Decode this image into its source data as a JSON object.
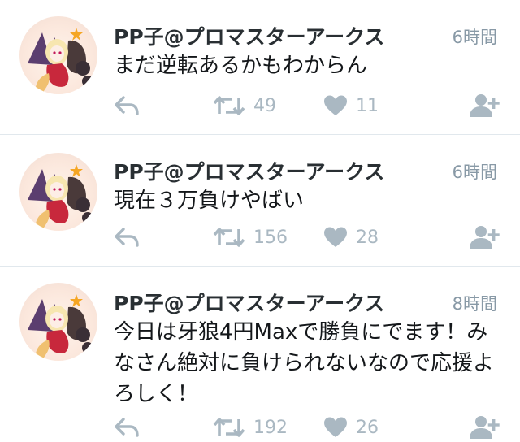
{
  "tweets": [
    {
      "user_name": "PP子@プロマスターアークス",
      "time": "6時間",
      "text": "まだ逆転あるかもわからん",
      "retweets": "49",
      "likes": "11"
    },
    {
      "user_name": "PP子@プロマスターアークス",
      "time": "6時間",
      "text": "現在３万負けやばい",
      "retweets": "156",
      "likes": "28"
    },
    {
      "user_name": "PP子@プロマスターアークス",
      "time": "8時間",
      "text": "今日は牙狼4円Maxで勝負にでます！みなさん絶対に負けられないなので応援よろしく！",
      "retweets": "192",
      "likes": "26"
    }
  ],
  "icons": {
    "reply": "reply-icon",
    "retweet": "retweet-icon",
    "like": "heart-icon",
    "follow": "follow-user-icon"
  },
  "colors": {
    "action_gray": "#aab8c2",
    "time_gray": "#8899a6",
    "divider": "#e1e8ed"
  }
}
